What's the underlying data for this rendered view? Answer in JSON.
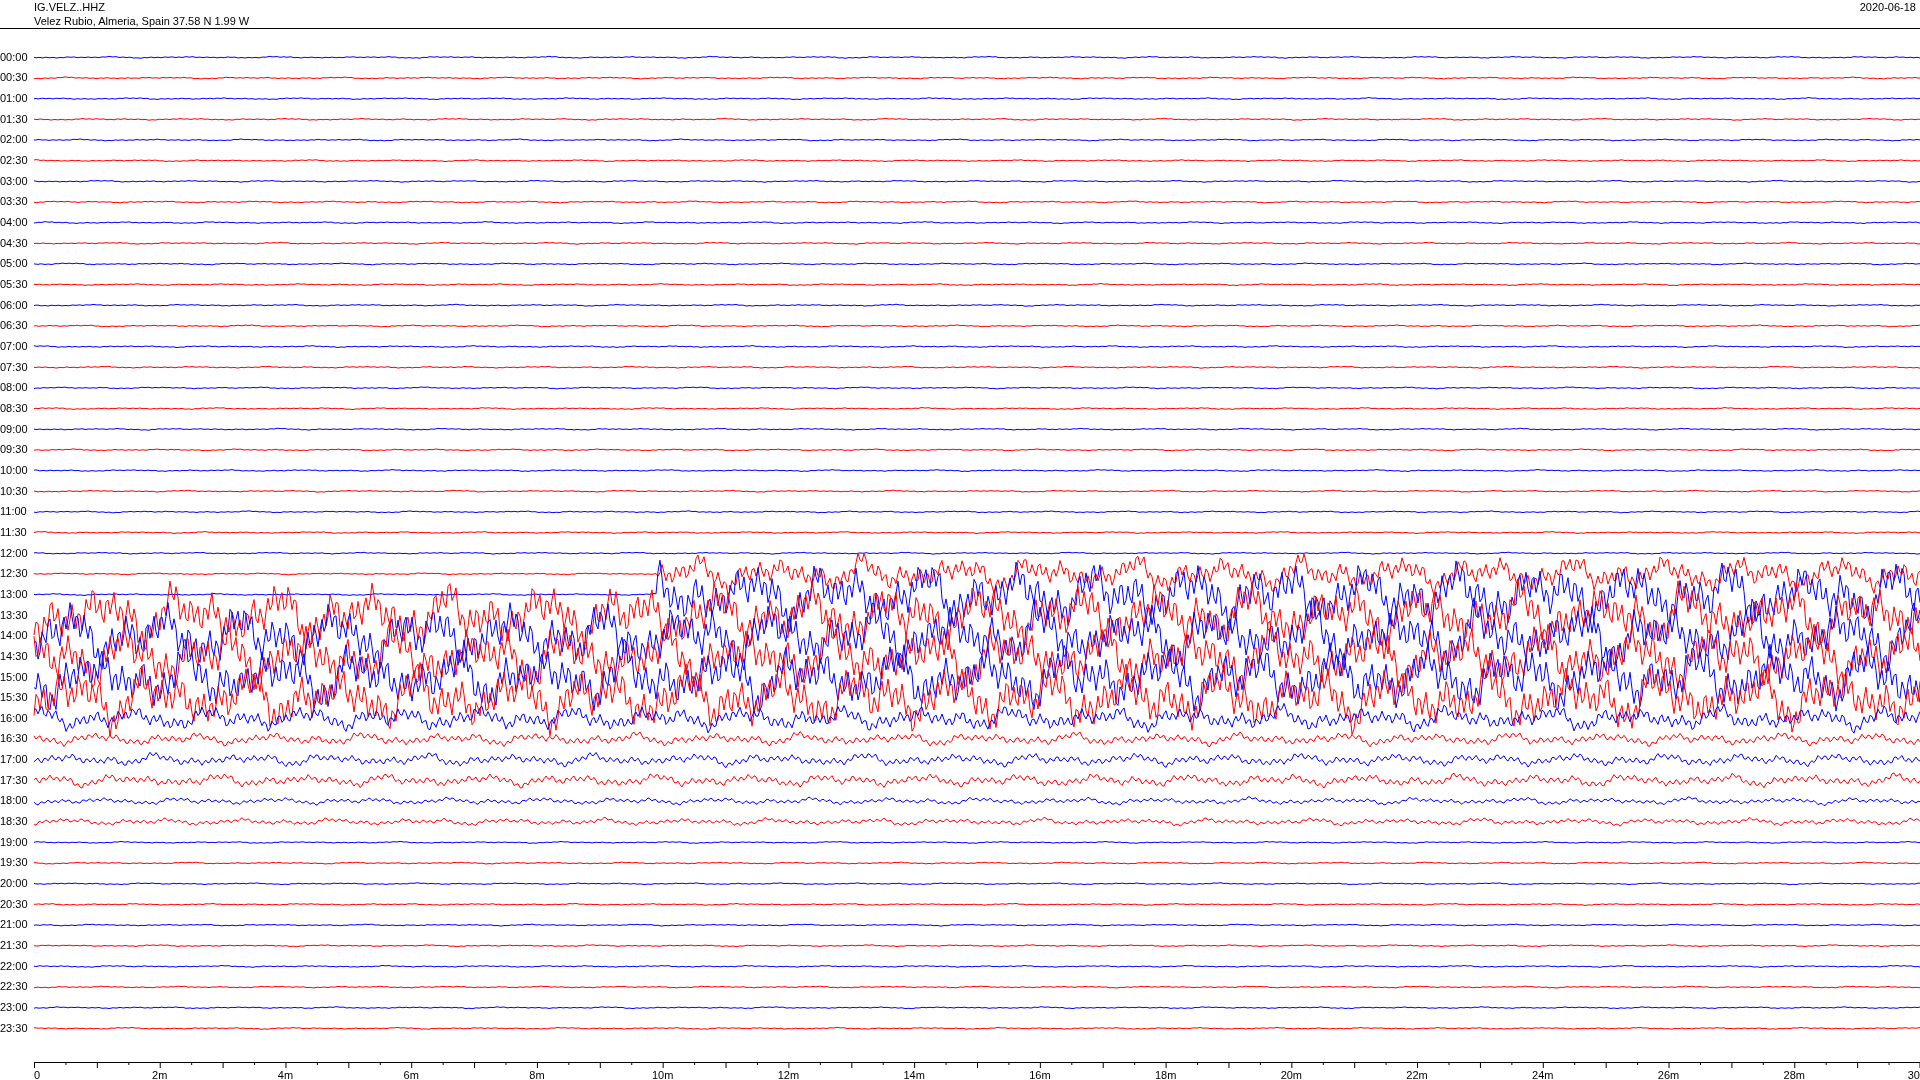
{
  "header": {
    "station": "IG.VELZ..HHZ",
    "location": "Velez Rubio, Almeria, Spain  37.58 N 1.99 W",
    "date": "2020-06-18"
  },
  "rows": [
    {
      "time": "00:00",
      "color": "#0000ff"
    },
    {
      "time": "00:30",
      "color": "#ff0000"
    },
    {
      "time": "01:00",
      "color": "#0000ff"
    },
    {
      "time": "01:30",
      "color": "#ff0000"
    },
    {
      "time": "02:00",
      "color": "#0000ff"
    },
    {
      "time": "02:30",
      "color": "#ff0000"
    },
    {
      "time": "03:00",
      "color": "#0000ff"
    },
    {
      "time": "03:30",
      "color": "#ff0000"
    },
    {
      "time": "04:00",
      "color": "#0000ff"
    },
    {
      "time": "04:30",
      "color": "#ff0000"
    },
    {
      "time": "05:00",
      "color": "#0000ff"
    },
    {
      "time": "05:30",
      "color": "#ff0000"
    },
    {
      "time": "06:00",
      "color": "#0000ff"
    },
    {
      "time": "06:30",
      "color": "#ff0000"
    },
    {
      "time": "07:00",
      "color": "#0000ff"
    },
    {
      "time": "07:30",
      "color": "#ff0000"
    },
    {
      "time": "08:00",
      "color": "#0000ff"
    },
    {
      "time": "08:30",
      "color": "#ff0000"
    },
    {
      "time": "09:00",
      "color": "#0000ff"
    },
    {
      "time": "09:30",
      "color": "#ff0000"
    },
    {
      "time": "10:00",
      "color": "#0000ff"
    },
    {
      "time": "10:30",
      "color": "#ff0000"
    },
    {
      "time": "11:00",
      "color": "#0000ff"
    },
    {
      "time": "11:30",
      "color": "#ff0000"
    },
    {
      "time": "12:00",
      "color": "#0000ff"
    },
    {
      "time": "12:30",
      "color": "#ff0000"
    },
    {
      "time": "13:00",
      "color": "#0000ff"
    },
    {
      "time": "13:30",
      "color": "#ff0000"
    },
    {
      "time": "14:00",
      "color": "#0000ff"
    },
    {
      "time": "14:30",
      "color": "#ff0000"
    },
    {
      "time": "15:00",
      "color": "#0000ff"
    },
    {
      "time": "15:30",
      "color": "#ff0000"
    },
    {
      "time": "16:00",
      "color": "#0000ff"
    },
    {
      "time": "16:30",
      "color": "#ff0000"
    },
    {
      "time": "17:00",
      "color": "#0000ff"
    },
    {
      "time": "17:30",
      "color": "#ff0000"
    },
    {
      "time": "18:00",
      "color": "#0000ff"
    },
    {
      "time": "18:30",
      "color": "#ff0000"
    },
    {
      "time": "19:00",
      "color": "#0000ff"
    },
    {
      "time": "19:30",
      "color": "#ff0000"
    },
    {
      "time": "20:00",
      "color": "#0000ff"
    },
    {
      "time": "20:30",
      "color": "#ff0000"
    },
    {
      "time": "21:00",
      "color": "#0000ff"
    },
    {
      "time": "21:30",
      "color": "#ff0000"
    },
    {
      "time": "22:00",
      "color": "#0000ff"
    },
    {
      "time": "22:30",
      "color": "#ff0000"
    },
    {
      "time": "23:00",
      "color": "#0000ff"
    },
    {
      "time": "23:30",
      "color": "#ff0000"
    }
  ],
  "x_axis": {
    "labels": [
      "0",
      "2m",
      "4m",
      "6m",
      "8m",
      "10m",
      "12m",
      "14m",
      "16m",
      "18m",
      "20m",
      "22m",
      "24m",
      "26m",
      "28m",
      "30"
    ]
  }
}
